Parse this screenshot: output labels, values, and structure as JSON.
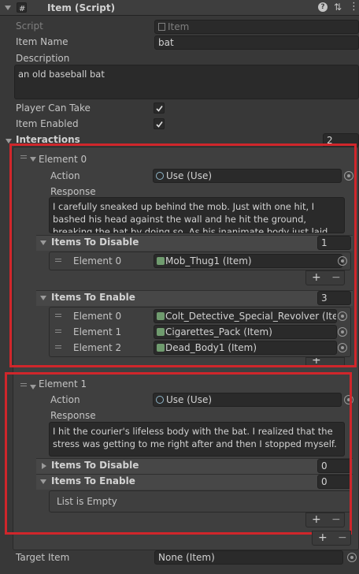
{
  "header": {
    "title": "Item (Script)"
  },
  "fields": {
    "script_label": "Script",
    "script_value": "Item",
    "item_name_label": "Item Name",
    "item_name_value": "bat",
    "description_label": "Description",
    "description_value": "an old baseball bat",
    "player_can_take_label": "Player Can Take",
    "item_enabled_label": "Item Enabled",
    "interactions_label": "Interactions",
    "interactions_count": "2",
    "target_item_label": "Target Item",
    "target_item_value": "None (Item)"
  },
  "element0": {
    "title": "Element 0",
    "action_label": "Action",
    "action_value": "Use (Use)",
    "response_label": "Response",
    "response_text": "I carefully sneaked up behind the mob. Just with one hit, I bashed his head against the wall and he hit the ground, breaking the bat by doing so. As his inanimate body just laid on the floor, his gun, a",
    "disable_label": "Items To Disable",
    "disable_count": "1",
    "disable_items": [
      {
        "label": "Element 0",
        "value": "Mob_Thug1 (Item)"
      }
    ],
    "enable_label": "Items To Enable",
    "enable_count": "3",
    "enable_items": [
      {
        "label": "Element 0",
        "value": "Colt_Detective_Special_Revolver (Item"
      },
      {
        "label": "Element 1",
        "value": "Cigarettes_Pack  (Item)"
      },
      {
        "label": "Element 2",
        "value": "Dead_Body1 (Item)"
      }
    ]
  },
  "element1": {
    "title": "Element 1",
    "action_label": "Action",
    "action_value": "Use (Use)",
    "response_label": "Response",
    "response_text": "I hit the courier's lifeless body with the bat. I realized that the stress was getting to me right after and then I stopped myself.",
    "disable_label": "Items To Disable",
    "disable_count": "0",
    "enable_label": "Items To Enable",
    "enable_count": "0",
    "empty_label": "List is Empty"
  },
  "buttons": {
    "plus": "+",
    "minus": "−"
  },
  "colors": {
    "background": "#383838",
    "field": "#2a2a2a",
    "highlight": "#d0262b"
  },
  "icons": [
    "script-icon",
    "help-icon",
    "presets-icon",
    "more-icon",
    "object-picker-icon",
    "foldout-arrow-icon",
    "drag-handle-icon",
    "checkmark-icon"
  ]
}
